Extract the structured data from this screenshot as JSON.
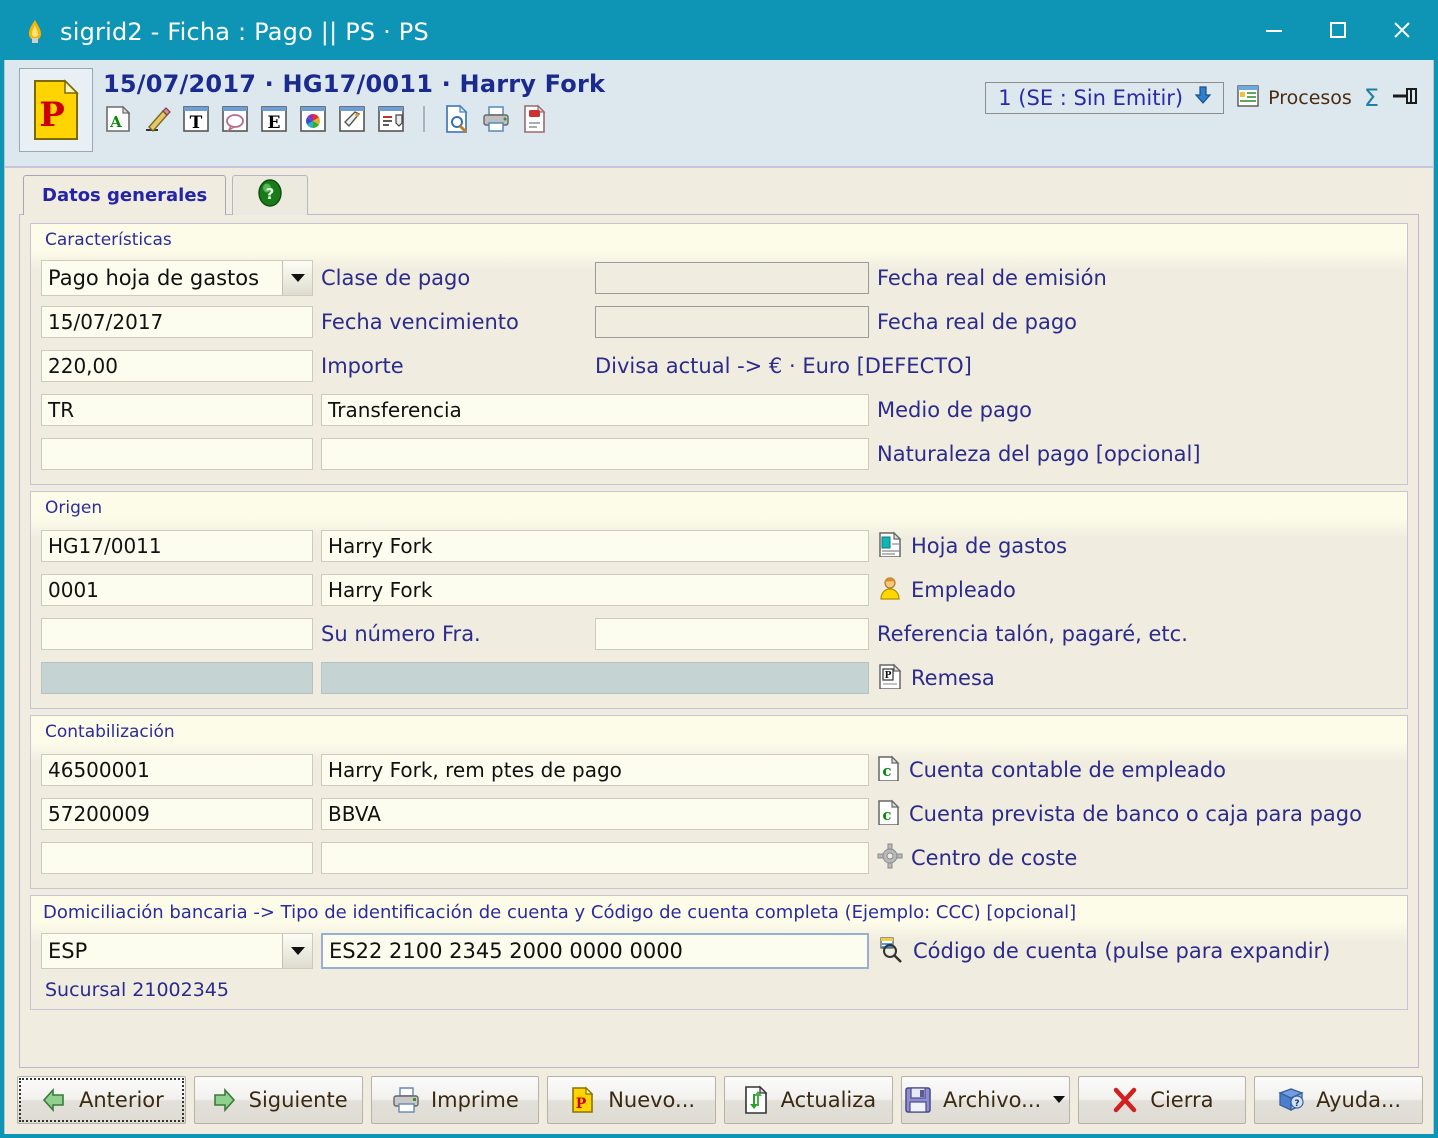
{
  "window": {
    "title": "sigrid2 - Ficha : Pago || PS · PS",
    "app_icon": "flame-icon",
    "minimize_label": "—",
    "maximize_label": "□",
    "close_label": "✕"
  },
  "header": {
    "doc_icon": "payment-document-icon",
    "doc_title": "15/07/2017 · HG17/0011 · Harry Fork",
    "toolbar_icons": [
      "annotation-a-icon",
      "pencil-icon",
      "text-tool-icon",
      "comment-balloon-icon",
      "stamp-e-icon",
      "color-wheel-icon",
      "tag-icon",
      "checklist-icon",
      "preview-document-icon",
      "print-icon",
      "pdf-export-icon"
    ],
    "status": {
      "text": "1 (SE : Sin Emitir)",
      "dropdown_icon": "down-arrow-icon"
    },
    "procesos": {
      "icon": "procesos-icon",
      "label": "Procesos"
    },
    "sum_symbol": "Σ",
    "pin_icon": "pin-icon"
  },
  "tabs": [
    {
      "label": "Datos generales",
      "selected": true
    },
    {
      "label": "?",
      "selected": false,
      "icon": "help-icon"
    }
  ],
  "groups": {
    "caracteristicas": {
      "title": "Características",
      "clase_de_pago": {
        "value": "Pago hoja de gastos",
        "label": "Clase de pago",
        "placeholder": ""
      },
      "fecha_real_emision": {
        "value": "",
        "label": "Fecha real de emisión"
      },
      "fecha_vencimiento": {
        "value": "15/07/2017",
        "label": "Fecha vencimiento"
      },
      "fecha_real_pago": {
        "value": "",
        "label": "Fecha real de pago"
      },
      "importe": {
        "value": "220,00",
        "label": "Importe"
      },
      "divisa": "Divisa actual -> € · Euro [DEFECTO]",
      "medio_de_pago": {
        "code": "TR",
        "desc": "Transferencia",
        "label": "Medio de pago"
      },
      "naturaleza_pago": {
        "code": "",
        "desc": "",
        "label": "Naturaleza del pago [opcional]"
      }
    },
    "origen": {
      "title": "Origen",
      "hoja_de_gastos": {
        "code": "HG17/0011",
        "desc": "Harry Fork",
        "label": "Hoja de gastos",
        "icon": "expense-sheet-icon"
      },
      "empleado": {
        "code": "0001",
        "desc": "Harry Fork",
        "label": "Empleado",
        "icon": "employee-icon"
      },
      "su_numero_fra": {
        "code": "",
        "label": "Su número Fra.",
        "ref_value": "",
        "ref_label": "Referencia talón, pagaré, etc."
      },
      "remesa": {
        "code": "",
        "desc": "",
        "label": "Remesa",
        "icon": "remesa-icon"
      }
    },
    "contabilizacion": {
      "title": "Contabilización",
      "cuenta_empleado": {
        "code": "46500001",
        "desc": "Harry Fork, rem ptes de pago",
        "label": "Cuenta contable de empleado",
        "icon": "account-c-icon"
      },
      "cuenta_banco": {
        "code": "57200009",
        "desc": "BBVA",
        "label": "Cuenta prevista de banco o caja para pago",
        "icon": "account-c-icon"
      },
      "centro_de_coste": {
        "code": "",
        "desc": "",
        "label": "Centro de coste",
        "icon": "cost-center-icon"
      }
    },
    "domiciliacion": {
      "title": "Domiciliación bancaria -> Tipo de identificación de cuenta y Código de cuenta completa (Ejemplo: CCC) [opcional]",
      "tipo": {
        "value": "ESP"
      },
      "codigo_cuenta": {
        "value": "ES22 2100 2345 2000 0000 0000",
        "label": "Código de cuenta (pulse para expandir)",
        "icon": "expand-account-icon"
      },
      "sucursal": "Sucursal 21002345"
    }
  },
  "buttons": [
    {
      "label": "Anterior",
      "icon": "arrow-left-icon",
      "focused": true
    },
    {
      "label": "Siguiente",
      "icon": "arrow-right-icon",
      "focused": false
    },
    {
      "label": "Imprime",
      "icon": "printer-icon",
      "focused": false
    },
    {
      "label": "Nuevo...",
      "icon": "new-document-icon",
      "focused": false
    },
    {
      "label": "Actualiza",
      "icon": "refresh-icon",
      "focused": false
    },
    {
      "label": "Archivo...",
      "icon": "save-icon",
      "focused": false,
      "has_menu": true
    },
    {
      "label": "Cierra",
      "icon": "close-x-icon",
      "focused": false
    },
    {
      "label": "Ayuda...",
      "icon": "help-book-icon",
      "focused": false
    }
  ],
  "colors": {
    "title_bar": "#0e94b5",
    "form_bg": "#f0ece0",
    "header_band": "#dde8ee",
    "field_bg": "#fdfdef",
    "field_disabled": "#c6d3d3",
    "label_blue": "#2b2b8c",
    "accent_red": "#d02020"
  }
}
